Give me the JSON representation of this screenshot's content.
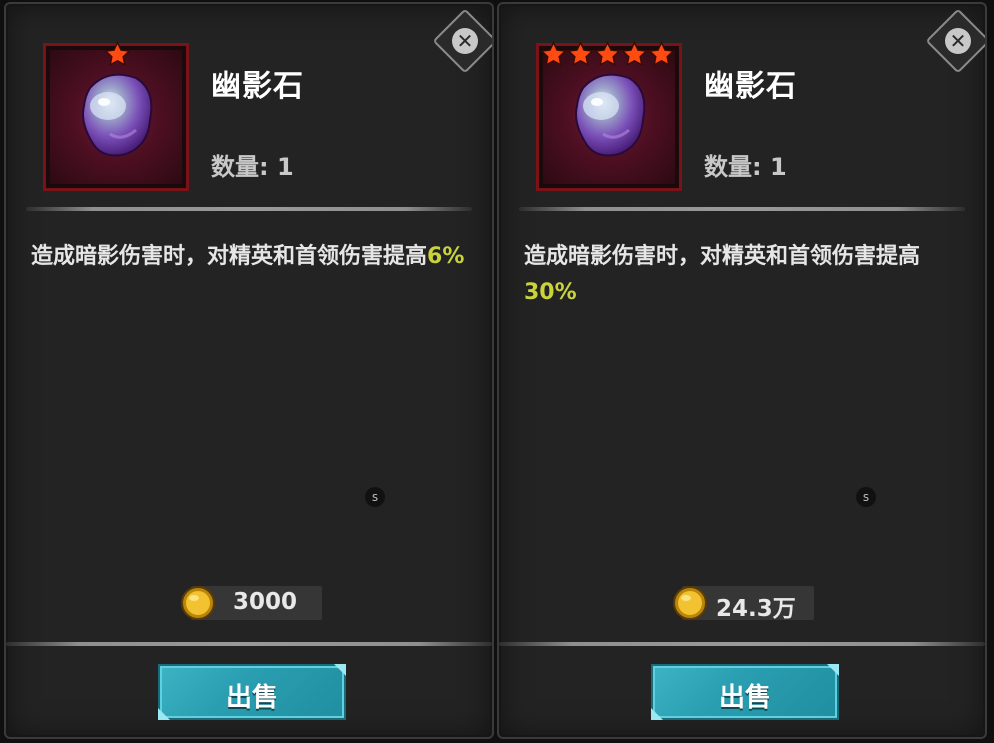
{
  "panels": [
    {
      "item_name": "幽影石",
      "star_count": 1,
      "quantity_text": "数量: 1",
      "description_prefix": "造成暗影伤害时，对精英和首领伤害提高",
      "description_value": "6%",
      "badge": "s",
      "price": "3000",
      "sell_label": "出售"
    },
    {
      "item_name": "幽影石",
      "star_count": 5,
      "quantity_text": "数量: 1",
      "description_prefix": "造成暗影伤害时，对精英和首领伤害提高",
      "description_value": "30%",
      "badge": "s",
      "price": "24.3万",
      "sell_label": "出售"
    }
  ],
  "icons": {
    "close": "close-icon",
    "coin": "gold-coin-icon",
    "star": "star-icon",
    "item": "shadow-stone-icon"
  },
  "colors": {
    "star": "#ff4a12",
    "highlight": "#c9d33a",
    "sell_button": "#2ea8ba",
    "icon_frame": "#7a1218"
  }
}
